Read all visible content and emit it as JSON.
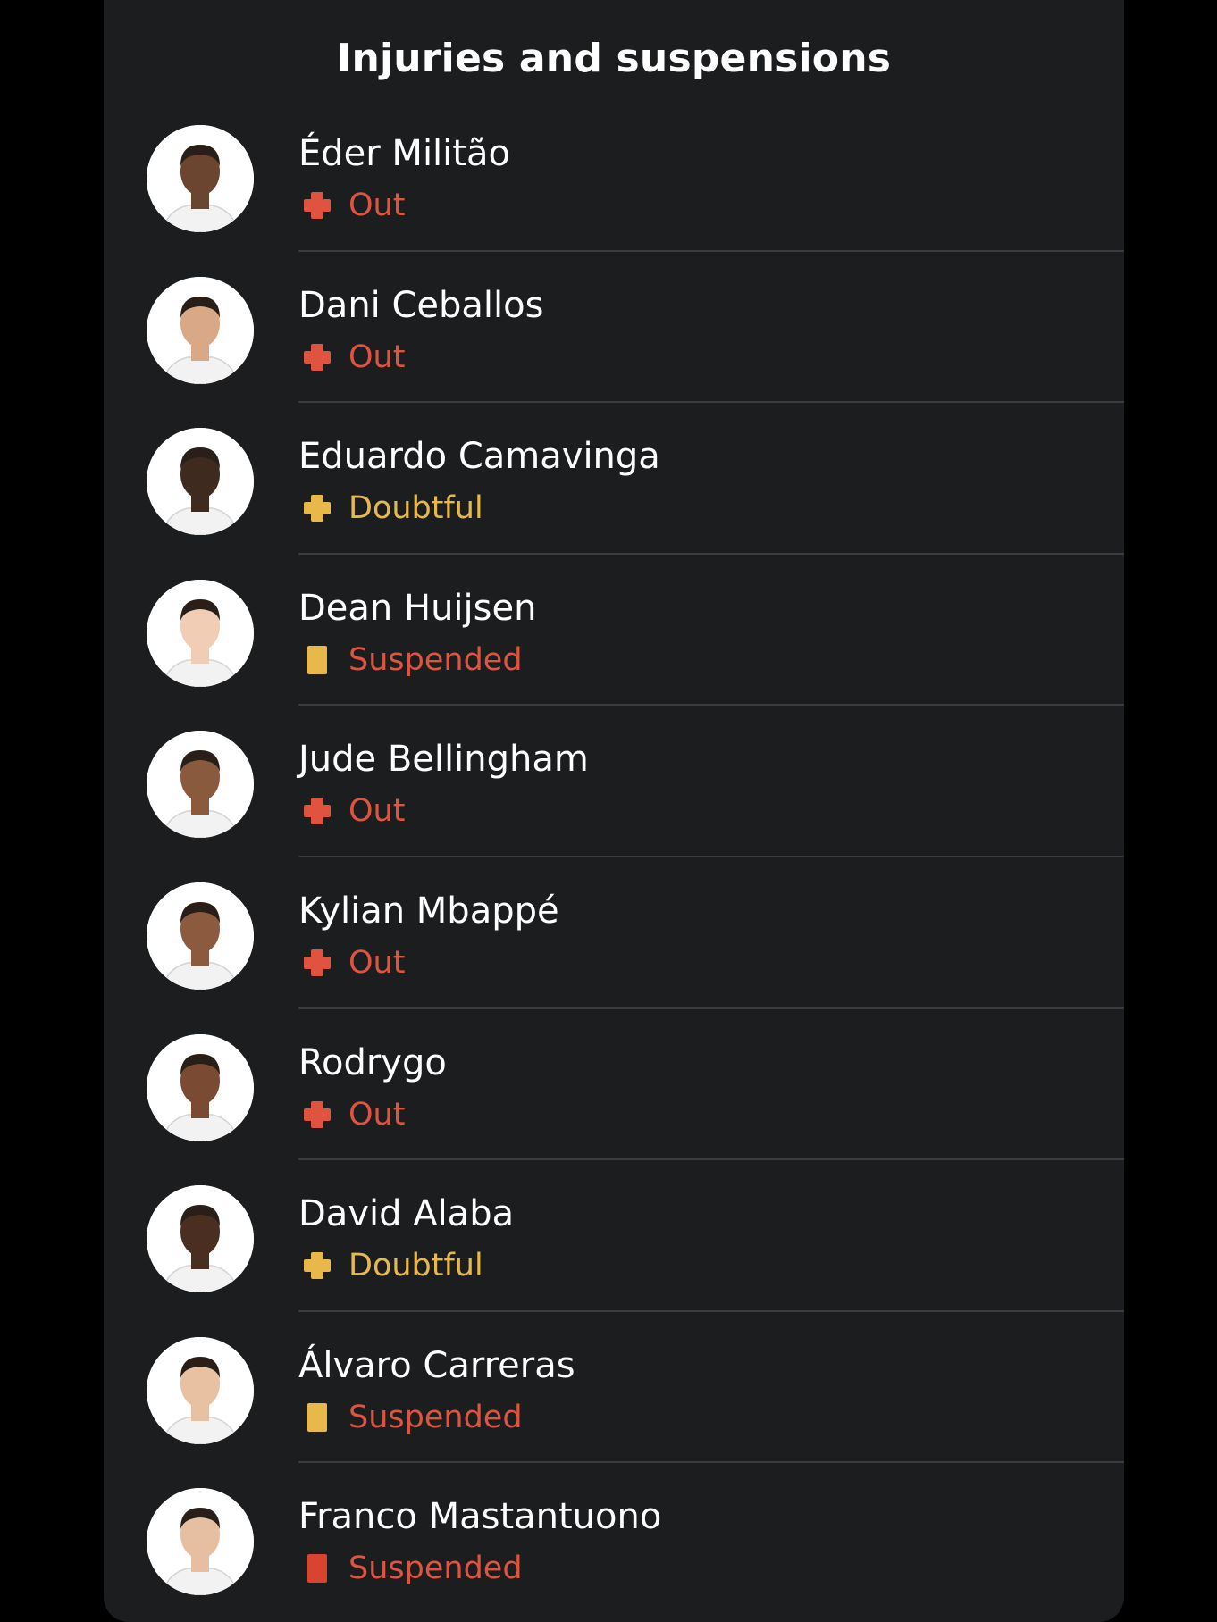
{
  "title": "Injuries and suspensions",
  "colors": {
    "background": "#000000",
    "card": "#1b1d1f",
    "out": "#e0533f",
    "doubtful": "#e8b84a",
    "suspended_text": "#e0533f",
    "yellow_card": "#e8b84a",
    "red_card": "#d9432f"
  },
  "players": [
    {
      "name": "Éder Militão",
      "status": "Out",
      "icon": "injury-cross-icon",
      "icon_color": "#e0533f",
      "status_color": "#e0533f",
      "skin": "#6b4530"
    },
    {
      "name": "Dani Ceballos",
      "status": "Out",
      "icon": "injury-cross-icon",
      "icon_color": "#e0533f",
      "status_color": "#e0533f",
      "skin": "#d9a886"
    },
    {
      "name": "Eduardo Camavinga",
      "status": "Doubtful",
      "icon": "injury-cross-icon",
      "icon_color": "#e8b84a",
      "status_color": "#e8b84a",
      "skin": "#3f2a1f"
    },
    {
      "name": "Dean Huijsen",
      "status": "Suspended",
      "icon": "yellow-card-icon",
      "icon_color": "#e8b84a",
      "status_color": "#e0533f",
      "skin": "#f0cdb4"
    },
    {
      "name": "Jude Bellingham",
      "status": "Out",
      "icon": "injury-cross-icon",
      "icon_color": "#e0533f",
      "status_color": "#e0533f",
      "skin": "#8a5a3e"
    },
    {
      "name": "Kylian Mbappé",
      "status": "Out",
      "icon": "injury-cross-icon",
      "icon_color": "#e0533f",
      "status_color": "#e0533f",
      "skin": "#8b5a3f"
    },
    {
      "name": "Rodrygo",
      "status": "Out",
      "icon": "injury-cross-icon",
      "icon_color": "#e0533f",
      "status_color": "#e0533f",
      "skin": "#7a4a32"
    },
    {
      "name": "David Alaba",
      "status": "Doubtful",
      "icon": "injury-cross-icon",
      "icon_color": "#e8b84a",
      "status_color": "#e8b84a",
      "skin": "#4a2e22"
    },
    {
      "name": "Álvaro Carreras",
      "status": "Suspended",
      "icon": "yellow-card-icon",
      "icon_color": "#e8b84a",
      "status_color": "#e0533f",
      "skin": "#e8c0a2"
    },
    {
      "name": "Franco Mastantuono",
      "status": "Suspended",
      "icon": "red-card-icon",
      "icon_color": "#d9432f",
      "status_color": "#e0533f",
      "skin": "#e6bfa2"
    }
  ]
}
